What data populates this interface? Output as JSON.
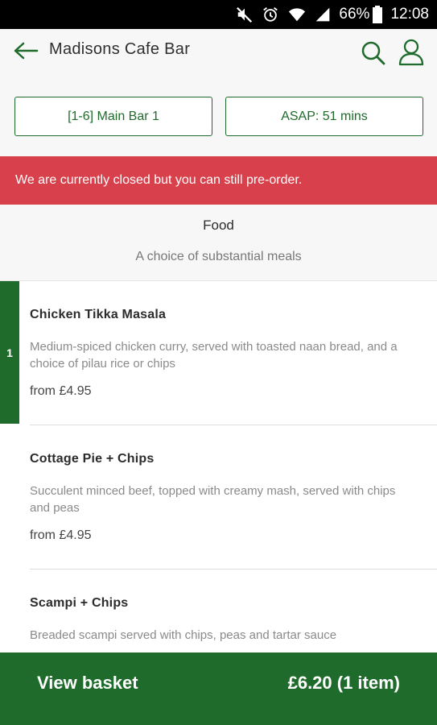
{
  "status_bar": {
    "icons": [
      "mute-icon",
      "alarm-icon",
      "wifi-icon",
      "signal-icon"
    ],
    "battery": "66%",
    "time": "12:08"
  },
  "header": {
    "back_icon": "arrow-left-icon",
    "title": "Madisons Cafe Bar",
    "search_icon": "search-icon",
    "account_icon": "user-icon"
  },
  "selectors": {
    "table": "[1-6] Main Bar 1",
    "time": "ASAP: 51 mins"
  },
  "banner": {
    "message": "We are currently closed but you can still pre-order.",
    "color": "#d8414c"
  },
  "category": {
    "title": "Food",
    "description": "A choice of substantial meals"
  },
  "menu_items": [
    {
      "name": "Chicken Tikka Masala",
      "description": "Medium-spiced chicken curry, served with toasted naan bread, and a choice of pilau rice or chips",
      "price": "from £4.95",
      "quantity": "1"
    },
    {
      "name": "Cottage Pie + Chips",
      "description": "Succulent minced beef, topped with creamy mash, served with chips and peas",
      "price": "from £4.95"
    },
    {
      "name": "Scampi + Chips",
      "description": "Breaded scampi served with chips, peas and tartar sauce",
      "price": ""
    }
  ],
  "basket": {
    "label": "View basket",
    "total": "£6.20 (1 item)"
  },
  "colors": {
    "brand": "#1f6b2c",
    "alert": "#d8414c"
  }
}
